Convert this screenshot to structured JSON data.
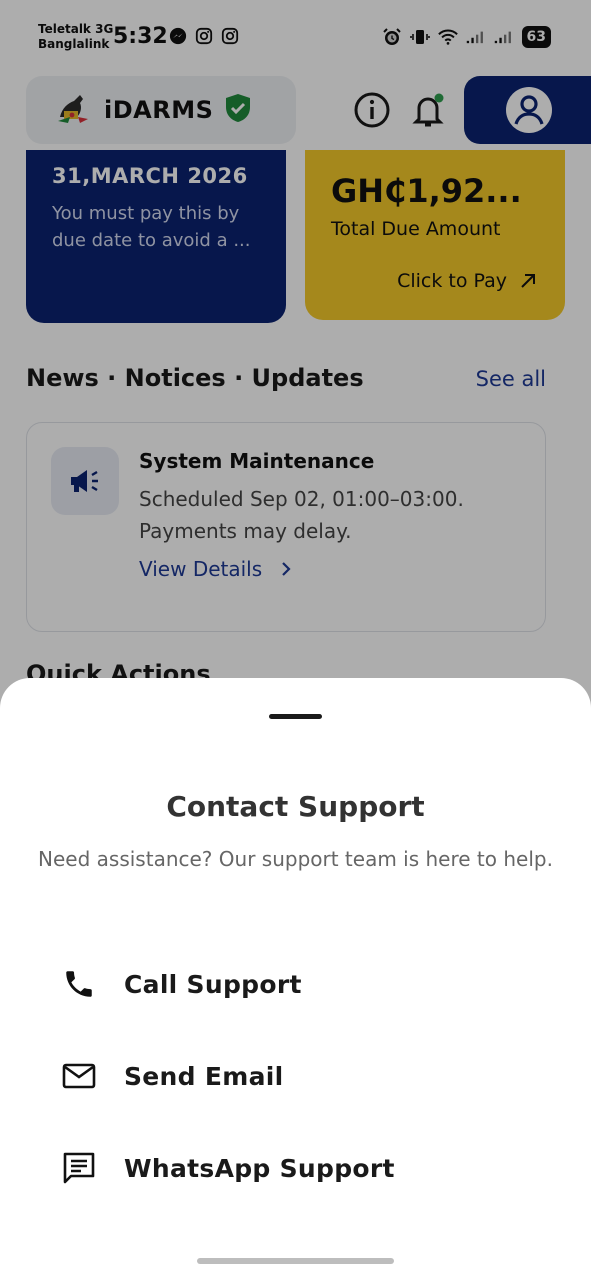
{
  "status_bar": {
    "carrier_1": "Teletalk 3G",
    "carrier_2": "Banglalink",
    "time": "5:32",
    "battery": "63"
  },
  "header": {
    "app_name": "iDARMS"
  },
  "due_card": {
    "date": "31,MARCH 2026",
    "note": "You must pay this by due date to avoid a ..."
  },
  "pay_card": {
    "amount": "GH₵1,92...",
    "label": "Total Due Amount",
    "cta": "Click to Pay"
  },
  "news": {
    "title": "News · Notices · Updates",
    "see_all": "See all",
    "items": [
      {
        "title": "System Maintenance",
        "body": "Scheduled Sep 02, 01:00–03:00. Payments may delay.",
        "link": "View Details"
      }
    ]
  },
  "quick_actions": {
    "title": "Quick Actions"
  },
  "sheet": {
    "title": "Contact Support",
    "subtitle": "Need assistance? Our support team is here to help.",
    "options": [
      {
        "label": "Call Support",
        "icon": "phone-icon"
      },
      {
        "label": "Send Email",
        "icon": "email-icon"
      },
      {
        "label": "WhatsApp Support",
        "icon": "chat-icon"
      }
    ]
  },
  "colors": {
    "brand_navy": "#0b2370",
    "accent_yellow": "#f3c92a",
    "link_blue": "#1e3a96",
    "shield_green": "#1f8a3c",
    "notification_dot": "#2e9e4f"
  }
}
